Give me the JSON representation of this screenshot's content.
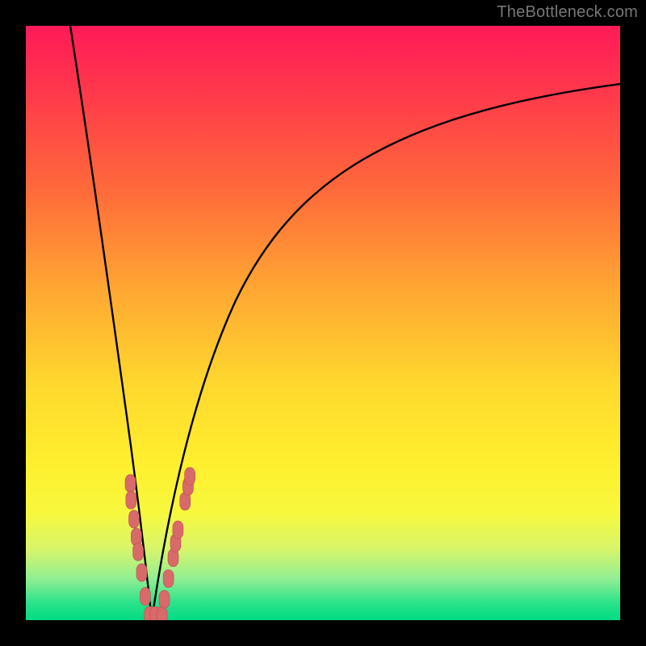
{
  "watermark": "TheBottleneck.com",
  "colors": {
    "frame": "#000000",
    "curve": "#000000",
    "marker_fill": "#d86a6a",
    "marker_stroke": "#b94f4f",
    "gradient_top": "#ff1a58",
    "gradient_bottom": "#00db84"
  },
  "chart_data": {
    "type": "line",
    "title": "",
    "xlabel": "",
    "ylabel": "",
    "xlim": [
      0,
      100
    ],
    "ylim": [
      0,
      100
    ],
    "grid": false,
    "note": "x is a normalized component-score axis (0–100, left→right); y is bottleneck percentage (0 = no bottleneck at bottom, 100 = full bottleneck at top). Optimal match is the valley minimum near x≈21.",
    "series": [
      {
        "name": "left-branch",
        "x": [
          7.5,
          9,
          10.5,
          12,
          13.5,
          15,
          16.5,
          18,
          19,
          20,
          21
        ],
        "y": [
          100,
          86,
          73,
          61,
          50,
          40,
          30,
          21,
          14,
          7,
          0
        ]
      },
      {
        "name": "right-branch",
        "x": [
          21,
          23,
          25,
          28,
          32,
          37,
          43,
          50,
          58,
          67,
          77,
          88,
          100
        ],
        "y": [
          0,
          9,
          18,
          28,
          38,
          48,
          57,
          65,
          72,
          78,
          83,
          87,
          90
        ]
      }
    ],
    "markers": {
      "name": "sample-points",
      "shape": "rounded-rect",
      "approx": true,
      "points": [
        {
          "x": 17.6,
          "y": 23.0
        },
        {
          "x": 17.7,
          "y": 20.2
        },
        {
          "x": 18.2,
          "y": 17.0
        },
        {
          "x": 18.6,
          "y": 14.0
        },
        {
          "x": 18.9,
          "y": 11.5
        },
        {
          "x": 19.5,
          "y": 8.0
        },
        {
          "x": 20.1,
          "y": 4.0
        },
        {
          "x": 20.8,
          "y": 0.8
        },
        {
          "x": 21.8,
          "y": 0.8
        },
        {
          "x": 22.9,
          "y": 0.8
        },
        {
          "x": 23.3,
          "y": 3.5
        },
        {
          "x": 24.0,
          "y": 7.0
        },
        {
          "x": 24.8,
          "y": 10.5
        },
        {
          "x": 25.2,
          "y": 13.0
        },
        {
          "x": 25.6,
          "y": 15.2
        },
        {
          "x": 26.8,
          "y": 20.0
        },
        {
          "x": 27.3,
          "y": 22.5
        },
        {
          "x": 27.6,
          "y": 24.2
        }
      ]
    }
  }
}
